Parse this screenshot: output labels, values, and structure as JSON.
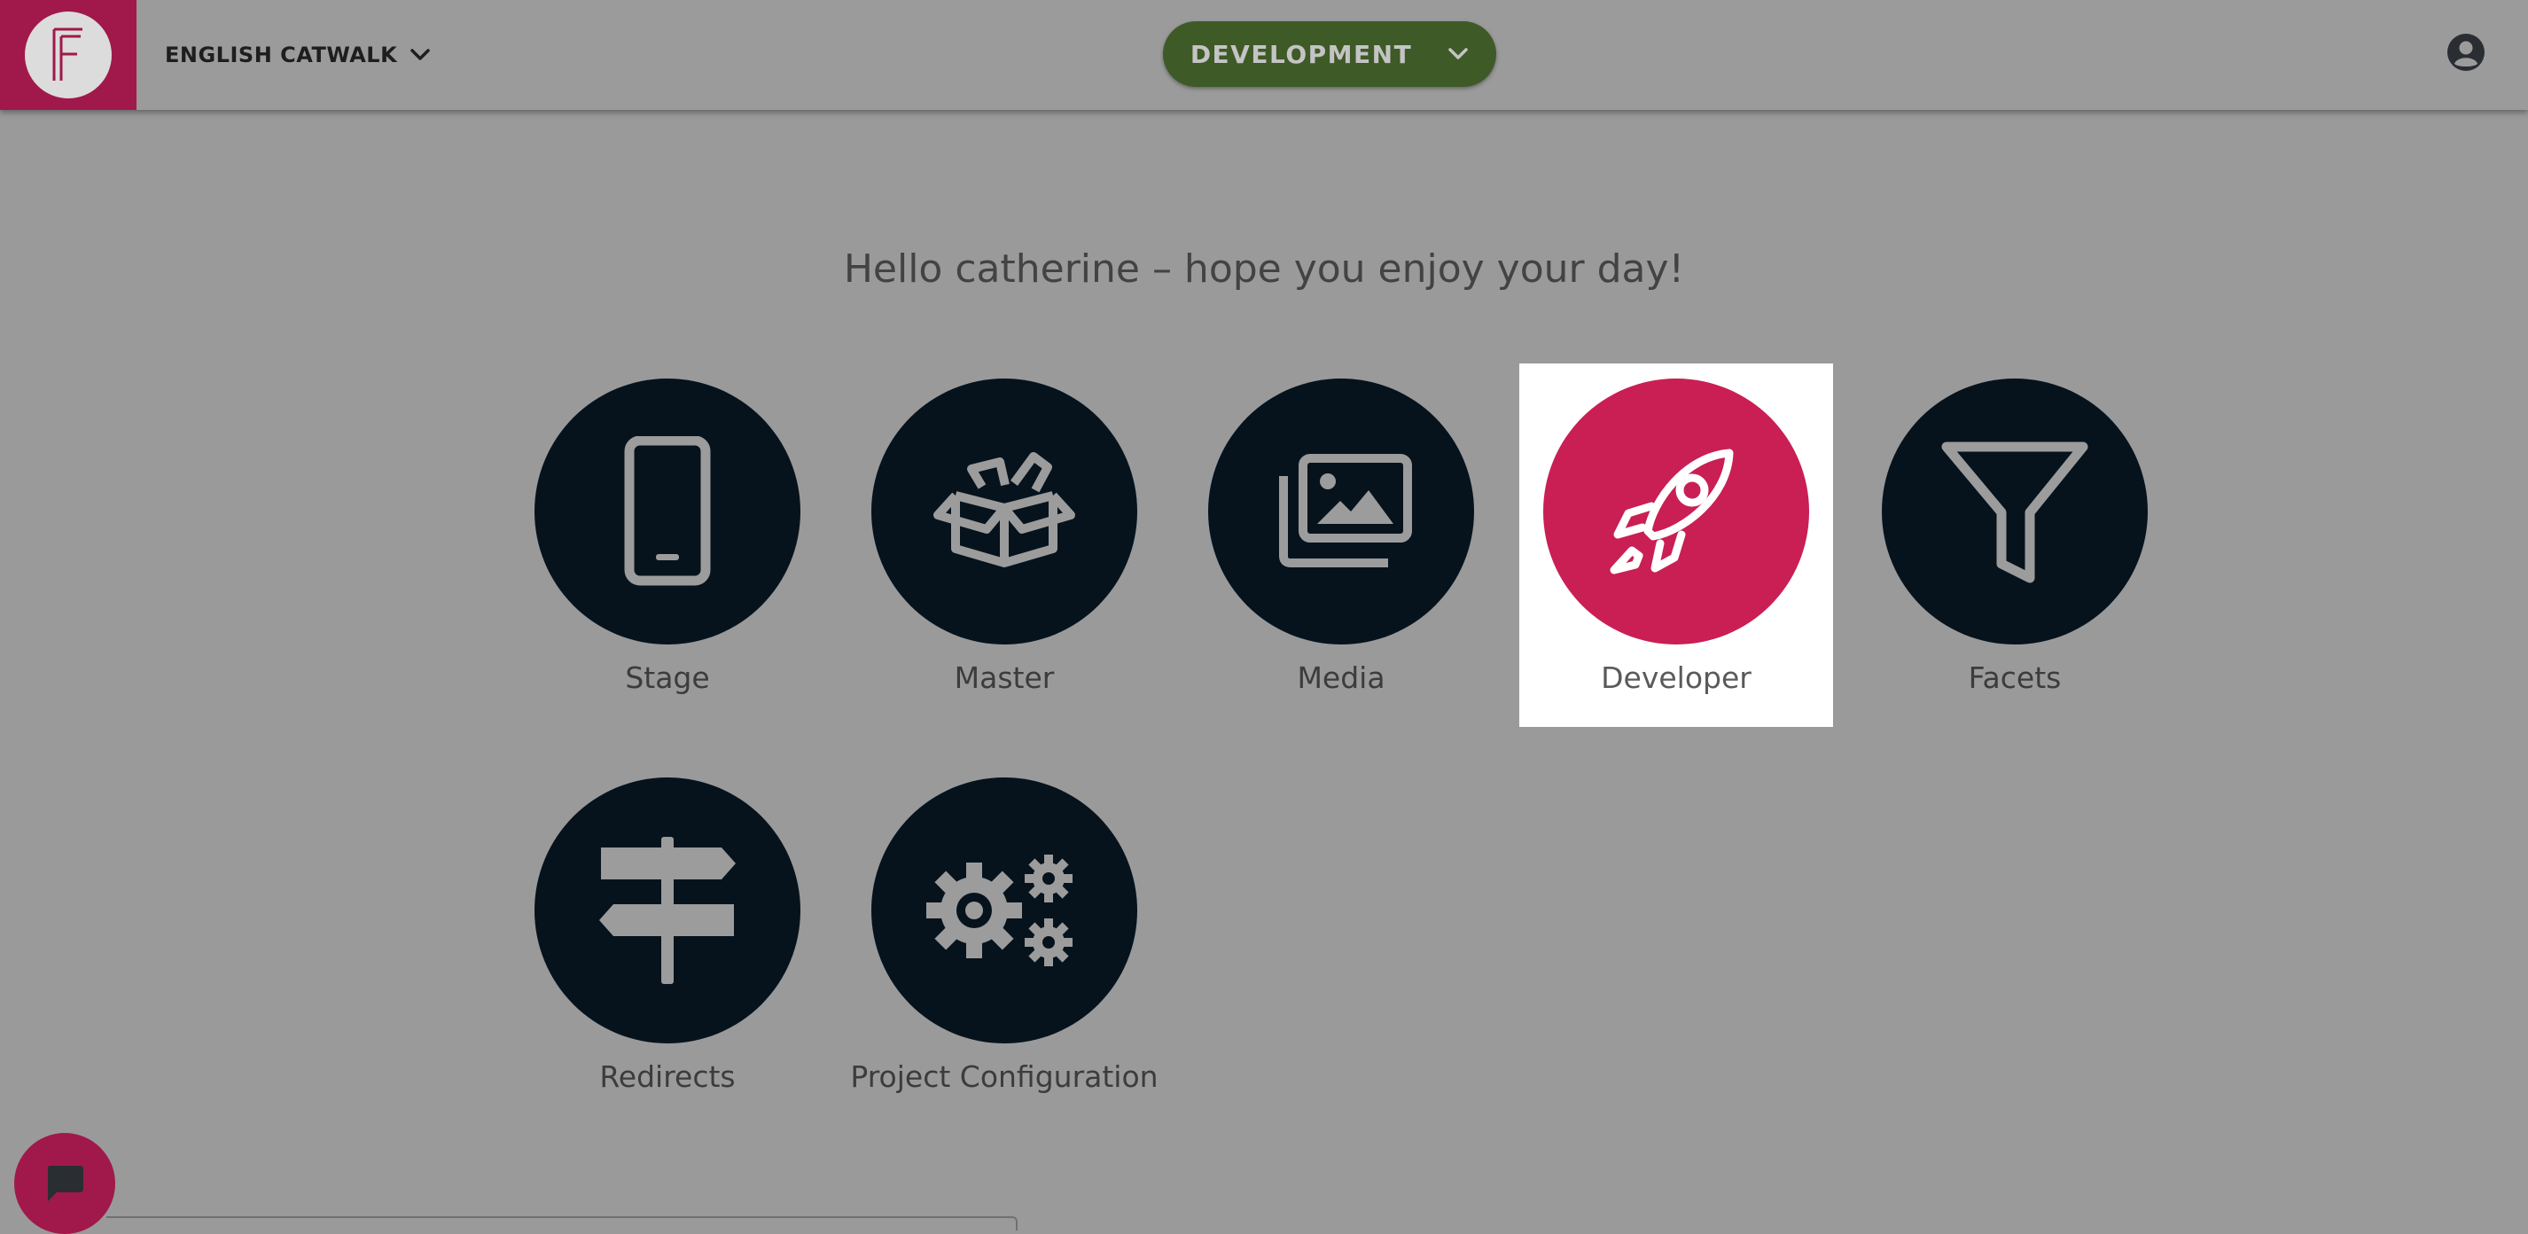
{
  "header": {
    "project_name": "ENGLISH CATWALK",
    "environment_label": "DEVELOPMENT",
    "colors": {
      "logo_bg": "#a0194a",
      "environment_bg": "#3e5a26"
    }
  },
  "greeting": "Hello catherine – hope you enjoy your day!",
  "tiles": [
    {
      "label": "Stage",
      "icon": "mobile-phone-icon"
    },
    {
      "label": "Master",
      "icon": "open-box-icon"
    },
    {
      "label": "Media",
      "icon": "images-icon"
    },
    {
      "label": "Developer",
      "icon": "rocket-icon",
      "active": true
    },
    {
      "label": "Facets",
      "icon": "funnel-icon"
    },
    {
      "label": "Redirects",
      "icon": "signpost-icon"
    },
    {
      "label": "Project Configuration",
      "icon": "gears-icon"
    }
  ],
  "colors": {
    "tile_circle": "#06131d",
    "active_circle": "#c91f54",
    "icon_stroke": "#9c9c9c"
  }
}
